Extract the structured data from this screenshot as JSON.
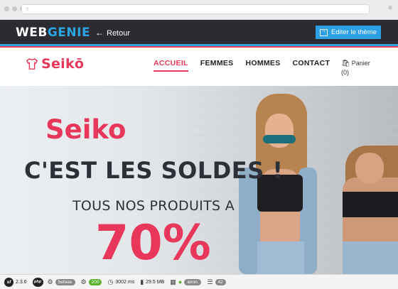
{
  "browser": {
    "menu_glyph": "≡"
  },
  "webgenie": {
    "logo_part1": "WEB",
    "logo_part2": "GENIE",
    "back_label": "Retour",
    "edit_button_label": "Editer le thème"
  },
  "site": {
    "brand": "Seikō",
    "nav": [
      {
        "label": "ACCUEIL",
        "active": true
      },
      {
        "label": "FEMMES",
        "active": false
      },
      {
        "label": "HOMMES",
        "active": false
      },
      {
        "label": "CONTACT",
        "active": false
      }
    ],
    "cart_label": "Panier",
    "cart_count": "(0)"
  },
  "hero": {
    "title": "Seiko",
    "headline": "C'EST LES SOLDES !",
    "subline": "TOUS NOS PRODUITS A",
    "percent": "70%"
  },
  "debug_toolbar": {
    "symfony_version": "2.3.6",
    "php_label": "php",
    "token": "5efeee",
    "status_code": "200",
    "time": "3002 ms",
    "memory": "29.5 MB",
    "user": "anon.",
    "queries": "42"
  },
  "colors": {
    "accent": "#e8375a",
    "webgenie_blue": "#2aa7e3",
    "dark_bar": "#2b2b31"
  }
}
